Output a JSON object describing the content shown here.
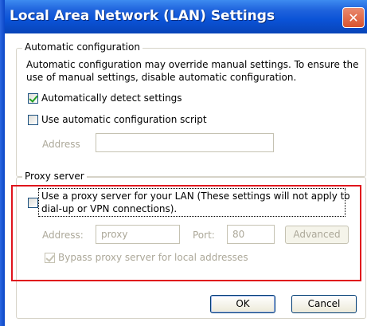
{
  "window": {
    "title": "Local Area Network (LAN) Settings",
    "close_glyph": "✕"
  },
  "auto_config": {
    "legend": "Automatic configuration",
    "description_line1": "Automatic configuration may override manual settings.  To ensure the",
    "description_line2": "use of manual settings, disable automatic configuration.",
    "detect_label": "Automatically detect settings",
    "detect_checked": true,
    "script_label": "Use automatic configuration script",
    "script_checked": false,
    "address_label": "Address",
    "address_value": ""
  },
  "proxy": {
    "legend": "Proxy server",
    "use_proxy_line1": "Use a proxy server for your LAN (These settings will not apply to",
    "use_proxy_line2": "dial-up or VPN connections).",
    "use_proxy_checked": false,
    "address_label": "Address:",
    "address_value": "proxy",
    "port_label": "Port:",
    "port_value": "80",
    "advanced_label": "Advanced",
    "bypass_label": "Bypass proxy server for local addresses",
    "bypass_checked": true
  },
  "buttons": {
    "ok": "OK",
    "cancel": "Cancel"
  },
  "colors": {
    "title_bar": "#0a52d6",
    "highlight_box": "#e0141c",
    "disabled_text": "#aca899"
  }
}
